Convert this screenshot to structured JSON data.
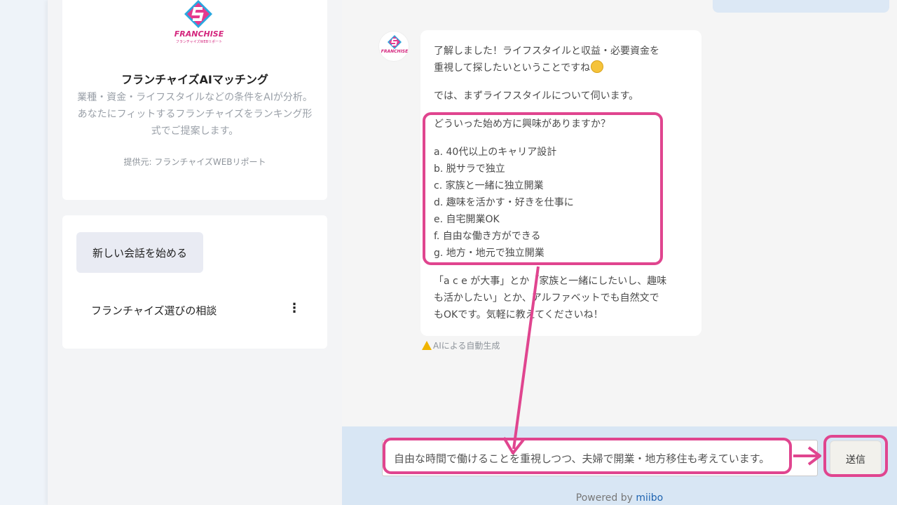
{
  "sidebar": {
    "logo": {
      "text": "FRANCHISE",
      "sub": "フランチャイズWEBリポート"
    },
    "title": "フランチャイズAIマッチング",
    "description": "業種・資金・ライフスタイルなどの条件をAIが分析。あなたにフィットするフランチャイズをランキング形式でご提案します。",
    "provider": "提供元: フランチャイズWEBリポート",
    "new_chat_label": "新しい会話を始める",
    "conversation_title": "フランチャイズ選びの相談",
    "menu_glyph": "⋮"
  },
  "chat": {
    "avatar_text": "FRANCHISE",
    "message": {
      "line1": "了解しました！ライフスタイルと収益・必要資金を",
      "line2": "重視して探したいということですね",
      "line3": "では、まずライフスタイルについて伺います。",
      "question": "どういった始め方に興味がありますか？",
      "options": [
        "a. 40代以上のキャリア設計",
        "b. 脱サラで独立",
        "c. 家族と一緒に独立開業",
        "d. 趣味を活かす・好きを仕事に",
        "e. 自宅開業OK",
        "f. 自由な働き方ができる",
        "g. 地方・地元で独立開業"
      ],
      "footer1": "「a c e が大事」とか「家族と一緒にしたいし、趣味",
      "footer2": "も活かしたい」とか、アルファベットでも自然文で",
      "footer3": "もOKです。気軽に教えてくださいね！"
    },
    "ai_note": "AIによる自動生成"
  },
  "composer": {
    "input_value": "自由な時間で働けることを重視しつつ、夫婦で開業・地方移住も考えています。",
    "send_label": "送信",
    "powered_prefix": "Powered by ",
    "powered_brand": "miibo"
  },
  "colors": {
    "accent_pink": "#e0458f",
    "logo_blue": "#2aa7df",
    "logo_pink": "#e5398e",
    "link_blue": "#1e63b0"
  },
  "icons": {
    "logo": "franchise-diamond-logo",
    "warning": "warning-icon",
    "menu": "kebab-menu-icon"
  }
}
